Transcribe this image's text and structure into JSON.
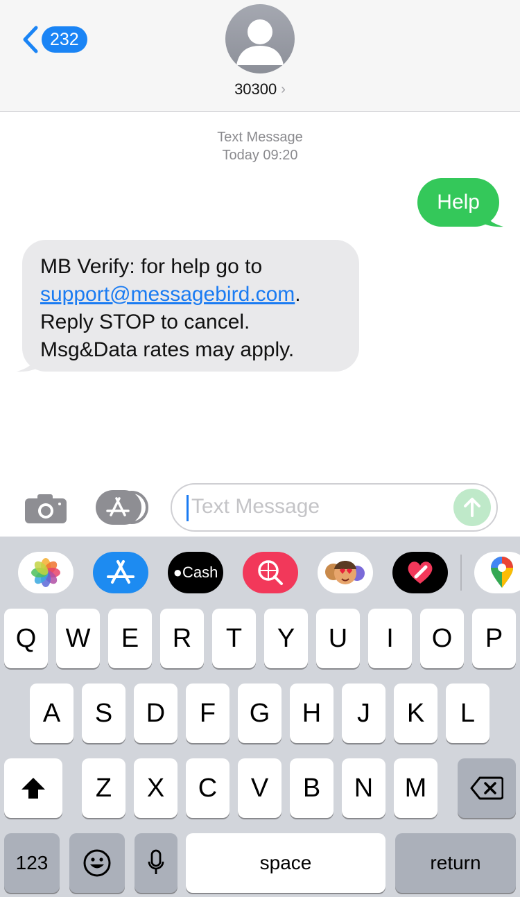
{
  "header": {
    "back_count": "232",
    "contact_name": "30300",
    "contact_chevron": "›"
  },
  "conversation": {
    "message_kind": "Text Message",
    "timestamp": "Today 09:20",
    "outgoing": {
      "text": "Help",
      "color": "#34c85a"
    },
    "incoming": {
      "text_before_link": "MB Verify: for help go to ",
      "link": "support@messagebird.com",
      "text_after_link": ".",
      "line3": "Reply STOP to cancel.",
      "line4": "Msg&Data rates may apply."
    }
  },
  "input": {
    "placeholder": "Text Message",
    "send_icon": "arrow-up-icon",
    "camera_icon": "camera-icon",
    "apps_icon": "app-store-icon"
  },
  "app_drawer": {
    "items": [
      {
        "name": "photos-app-icon"
      },
      {
        "name": "app-store-app-icon"
      },
      {
        "name": "apple-cash-app-icon",
        "label": "Cash"
      },
      {
        "name": "search-images-app-icon"
      },
      {
        "name": "memoji-stickers-app-icon"
      },
      {
        "name": "digital-touch-app-icon"
      },
      {
        "name": "google-maps-app-icon"
      }
    ]
  },
  "keyboard": {
    "row1": [
      "Q",
      "W",
      "E",
      "R",
      "T",
      "Y",
      "U",
      "I",
      "O",
      "P"
    ],
    "row2": [
      "A",
      "S",
      "D",
      "F",
      "G",
      "H",
      "J",
      "K",
      "L"
    ],
    "row3": [
      "Z",
      "X",
      "C",
      "V",
      "B",
      "N",
      "M"
    ],
    "numbers_label": "123",
    "space_label": "space",
    "return_label": "return",
    "shift_icon": "shift-icon",
    "delete_icon": "delete-icon",
    "emoji_icon": "emoji-icon",
    "mic_icon": "microphone-icon"
  },
  "colors": {
    "accent": "#1a84f5",
    "sent_bubble": "#34c85a",
    "received_bubble": "#e9e9eb",
    "keyboard_bg": "#d2d5db"
  }
}
